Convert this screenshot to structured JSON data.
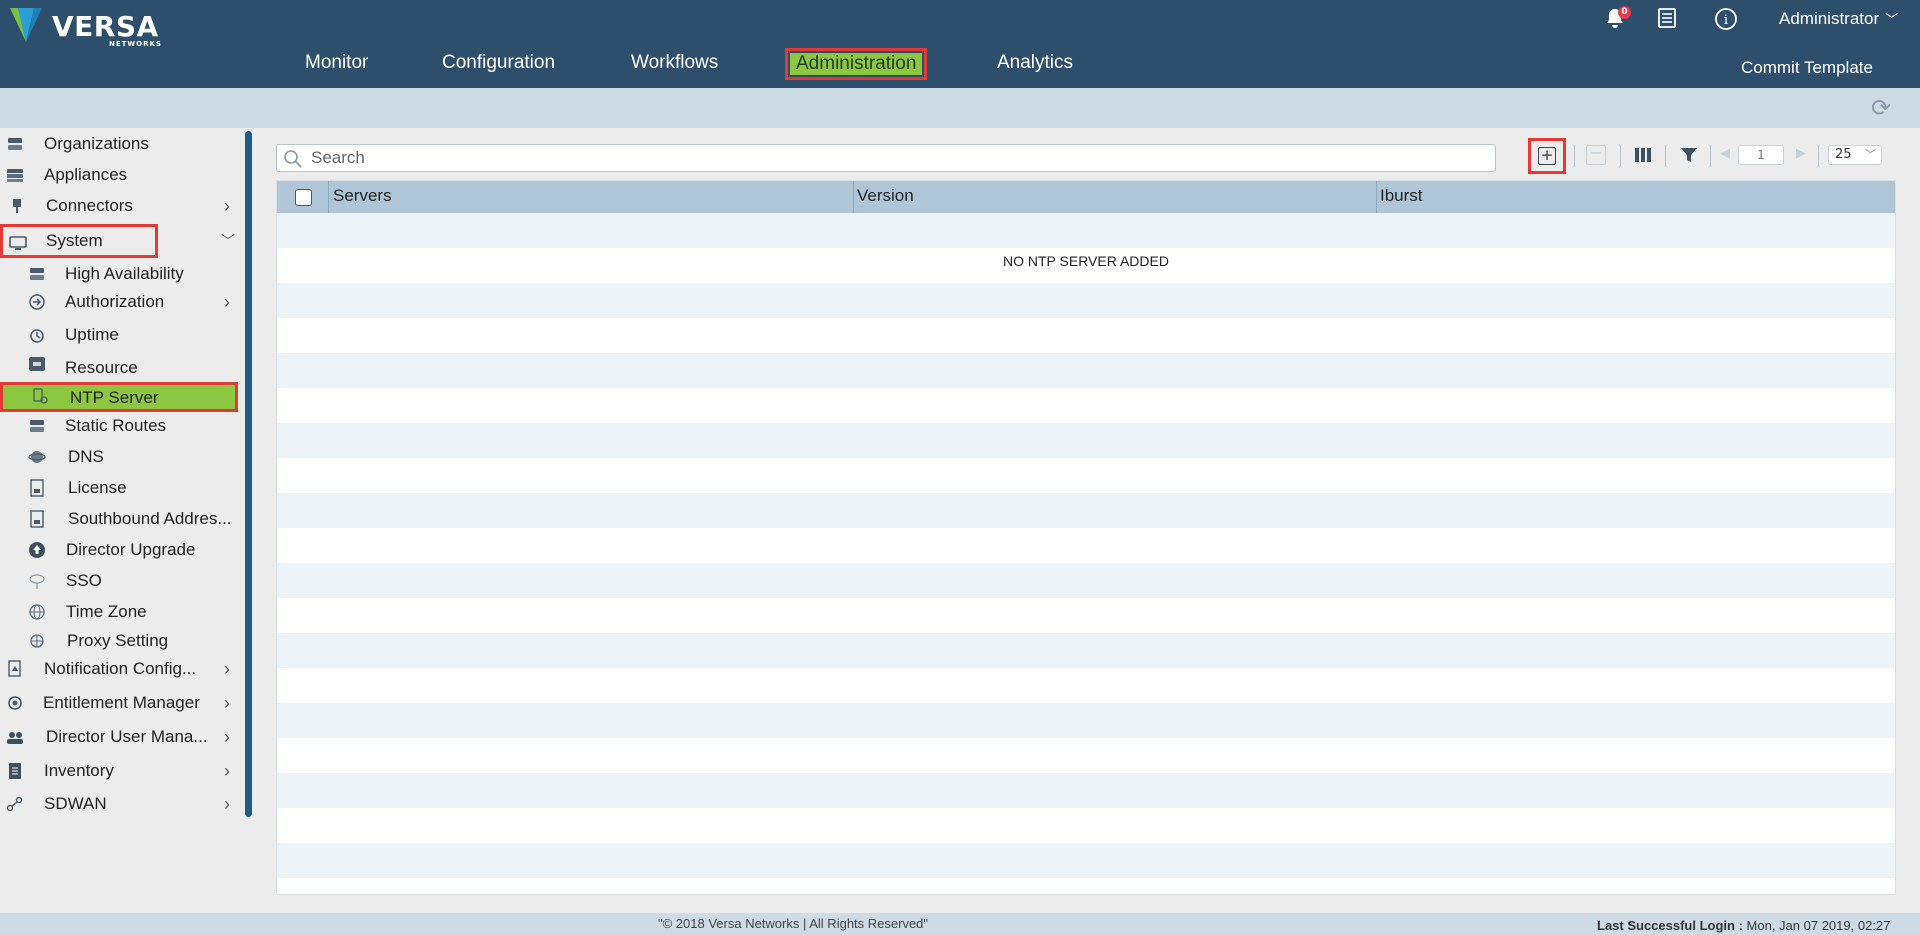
{
  "app": {
    "brand": "VERSA",
    "brand_sub": "NETWORKS",
    "notification_count": "0",
    "user": "Administrator"
  },
  "nav": {
    "items": [
      "Monitor",
      "Configuration",
      "Workflows",
      "Administration",
      "Analytics"
    ],
    "active": "Administration",
    "commit_label": "Commit Template"
  },
  "sidebar": {
    "items": [
      {
        "label": "Organizations",
        "icon": "organizations-icon"
      },
      {
        "label": "Appliances",
        "icon": "appliances-icon"
      },
      {
        "label": "Connectors",
        "icon": "connectors-icon",
        "expandable": true
      },
      {
        "label": "System",
        "icon": "system-icon",
        "expanded": true
      },
      {
        "label": "High Availability",
        "icon": "high-availability-icon"
      },
      {
        "label": "Authorization",
        "icon": "authorization-icon",
        "expandable": true
      },
      {
        "label": "Uptime",
        "icon": "uptime-icon"
      },
      {
        "label": "Resource",
        "icon": "resource-icon"
      },
      {
        "label": "NTP Server",
        "icon": "ntp-server-icon",
        "selected": true
      },
      {
        "label": "Static Routes",
        "icon": "static-routes-icon"
      },
      {
        "label": "DNS",
        "icon": "dns-icon"
      },
      {
        "label": "License",
        "icon": "license-icon"
      },
      {
        "label": "Southbound Addres...",
        "icon": "southbound-address-icon"
      },
      {
        "label": "Director Upgrade",
        "icon": "director-upgrade-icon"
      },
      {
        "label": "SSO",
        "icon": "sso-icon"
      },
      {
        "label": "Time Zone",
        "icon": "time-zone-icon"
      },
      {
        "label": "Proxy Setting",
        "icon": "proxy-setting-icon"
      },
      {
        "label": "Notification Config...",
        "icon": "notification-config-icon",
        "expandable": true
      },
      {
        "label": "Entitlement Manager",
        "icon": "entitlement-manager-icon",
        "expandable": true
      },
      {
        "label": "Director User Mana...",
        "icon": "director-user-management-icon",
        "expandable": true
      },
      {
        "label": "Inventory",
        "icon": "inventory-icon",
        "expandable": true
      },
      {
        "label": "SDWAN",
        "icon": "sdwan-icon",
        "expandable": true
      }
    ]
  },
  "toolbar": {
    "search_placeholder": "Search",
    "page_number": "1",
    "page_size": "25"
  },
  "grid": {
    "columns": [
      "Servers",
      "Version",
      "Iburst"
    ],
    "empty_message": "NO NTP SERVER ADDED"
  },
  "footer": {
    "copyright": "\"© 2018 Versa Networks | All Rights Reserved\"",
    "last_login_label": "Last Successful Login :",
    "last_login_value": " Mon, Jan 07 2019, 02:27"
  },
  "colors": {
    "header": "#2d4f6c",
    "active_green": "#8dc63f",
    "highlight_red": "#e53935",
    "grid_header": "#afc6d8"
  }
}
